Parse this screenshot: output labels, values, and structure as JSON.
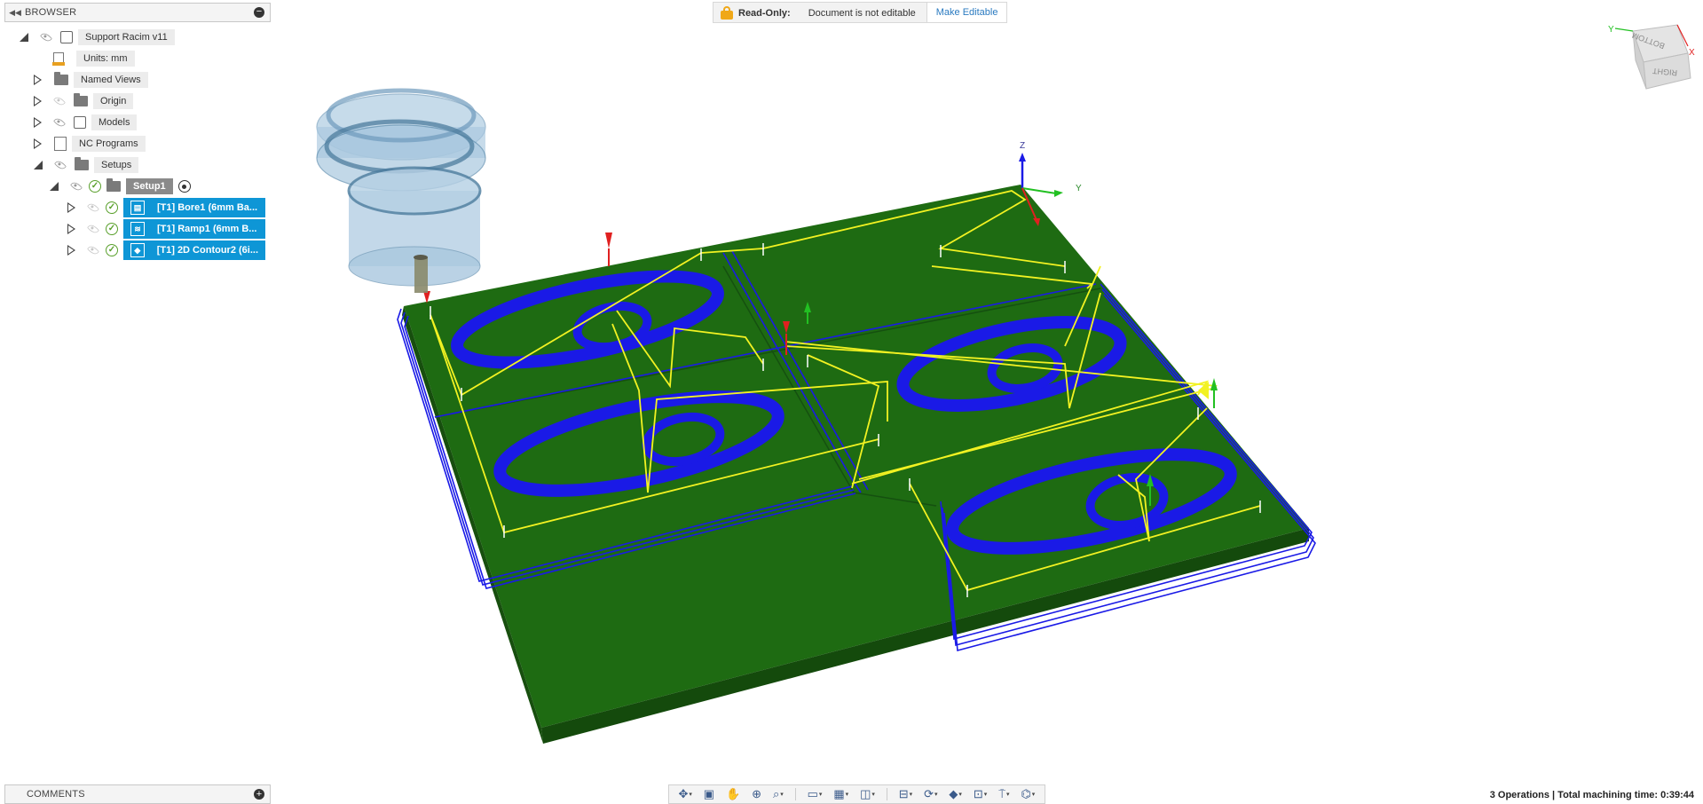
{
  "browser": {
    "title": "BROWSER",
    "root_label": "Support Racim v11",
    "units_label": "Units: mm",
    "items": [
      {
        "label": "Named Views"
      },
      {
        "label": "Origin"
      },
      {
        "label": "Models"
      },
      {
        "label": "NC Programs"
      },
      {
        "label": "Setups"
      }
    ],
    "setup_label": "Setup1",
    "operations": [
      {
        "label": "[T1] Bore1 (6mm Ba..."
      },
      {
        "label": "[T1] Ramp1 (6mm B..."
      },
      {
        "label": "[T1] 2D Contour2 (6i..."
      }
    ]
  },
  "banner": {
    "readonly_label": "Read-Only:",
    "readonly_text": "Document is not editable",
    "make_editable": "Make Editable"
  },
  "axes": {
    "z": "Z",
    "y": "Y"
  },
  "viewcube": {
    "face_right": "RIGHT",
    "face_top": "BOTTOM",
    "axis_x": "X",
    "axis_y": "Y"
  },
  "comments": {
    "title": "COMMENTS"
  },
  "status": {
    "text": "3 Operations | Total machining time: 0:39:44"
  },
  "colors": {
    "stock_green": "#1e6b12",
    "toolpath_blue": "#1a1ae6",
    "rapid_yellow": "#f2f222",
    "selection_blue": "#0e96d6",
    "tool_holder": "#8fb8d6"
  }
}
